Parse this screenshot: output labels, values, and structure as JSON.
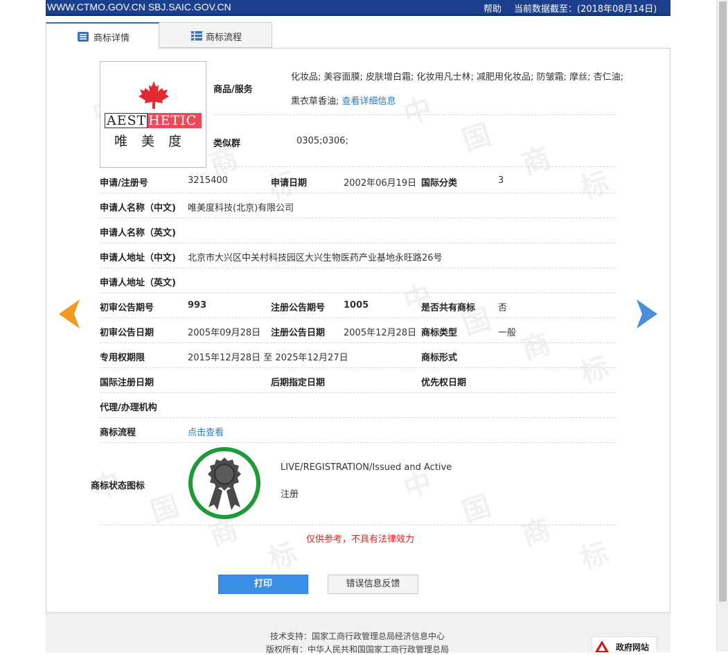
{
  "header": {
    "site": "WWW.CTMO.GOV.CN SBJ.SAIC.GOV.CN",
    "help": "帮助",
    "data_date": "当前数据截至：(2018年08月14日)"
  },
  "tabs": [
    {
      "label": "商标详情",
      "icon": "list-icon",
      "active": true
    },
    {
      "label": "商标流程",
      "icon": "grid-icon",
      "active": false
    }
  ],
  "logo": {
    "brand_left": "AEST",
    "brand_right": "HETIC",
    "chinese": "唯美度",
    "icon": "maple-leaf-icon"
  },
  "details": {
    "goods_label": "商品/服务",
    "goods_line1": "化妆品; 美容面膜; 皮肤增白霜; 化妆用凡士林; 减肥用化妆品; 防皱霜; 摩丝; 杏仁油;",
    "goods_line2": "熏衣草香油;",
    "goods_more": "查看详细信息",
    "similar_label": "类似群",
    "similar_value": "0305;0306;",
    "reg_no_label": "申请/注册号",
    "reg_no": "3215400",
    "apply_date_label": "申请日期",
    "apply_date": "2002年06月19日",
    "intl_class_label": "国际分类",
    "intl_class": "3",
    "applicant_cn_label": "申请人名称（中文)",
    "applicant_cn": "唯美度科技(北京)有限公司",
    "applicant_en_label": "申请人名称（英文)",
    "address_cn_label": "申请人地址（中文)",
    "address_cn": "北京市大兴区中关村科技园区大兴生物医药产业基地永旺路26号",
    "address_en_label": "申请人地址（英文)",
    "prelim_no_label": "初审公告期号",
    "prelim_no": "993",
    "reg_ann_no_label": "注册公告期号",
    "reg_ann_no": "1005",
    "shared_label": "是否共有商标",
    "shared": "否",
    "prelim_date_label": "初审公告日期",
    "prelim_date": "2005年09月28日",
    "reg_ann_date_label": "注册公告日期",
    "reg_ann_date": "2005年12月28日",
    "tm_type_label": "商标类型",
    "tm_type": "一般",
    "exclusive_label": "专用权期限",
    "exclusive": "2015年12月28日 至 2025年12月27日",
    "tm_form_label": "商标形式",
    "intl_reg_date_label": "国际注册日期",
    "later_date_label": "后期指定日期",
    "priority_label": "优先权日期",
    "agent_label": "代理/办理机构",
    "flow_label": "商标流程",
    "flow_link": "点击查看",
    "status_label": "商标状态图标",
    "status_en": "LIVE/REGISTRATION/Issued and Active",
    "status_cn": "注册"
  },
  "notice": "仅供参考，不具有法律效力",
  "buttons": {
    "print": "打印",
    "feedback": "错误信息反馈"
  },
  "footer": {
    "support": "技术支持：国家工商行政管理总局经济信息中心",
    "copyright": "版权所有：中华人民共和国国家工商行政管理总局",
    "gov_badge": "政府网站"
  },
  "watermark": [
    "中",
    "国",
    "商",
    "标"
  ],
  "colors": {
    "accent": "#2e6fc4",
    "link": "#2f7bbd",
    "notice": "#e0201f",
    "left_arrow": "#f29a1f",
    "right_arrow": "#4a90d9",
    "status_ring": "#1e9a38"
  }
}
